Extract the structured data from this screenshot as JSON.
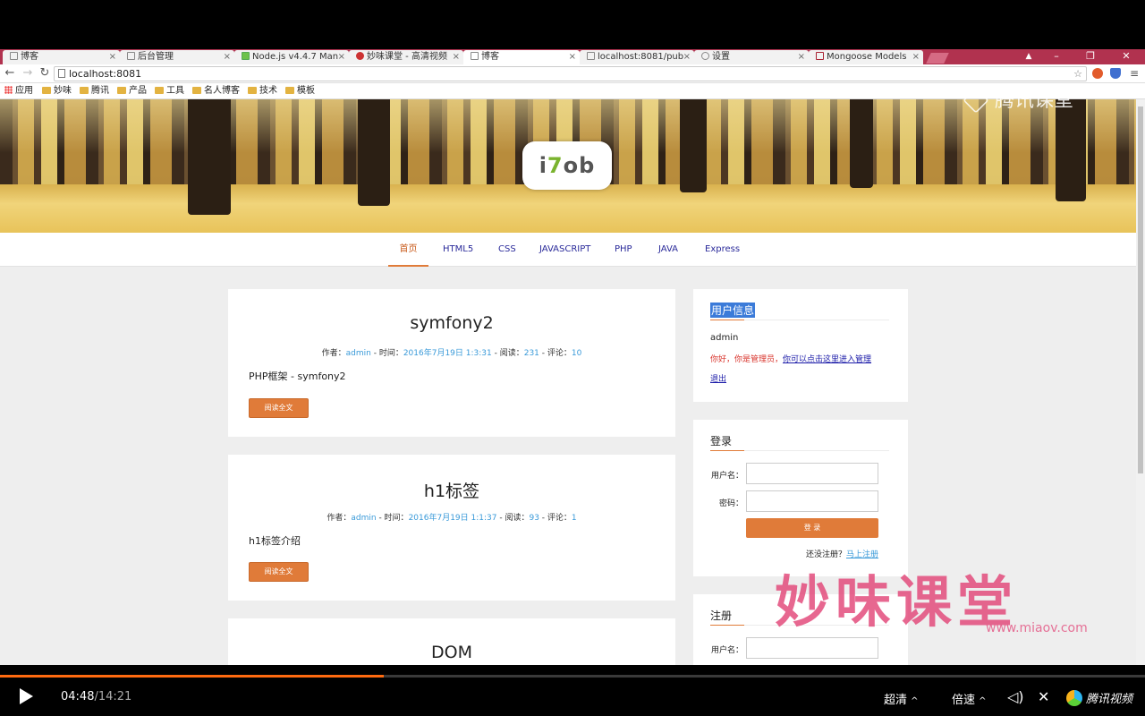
{
  "browser": {
    "tabs": [
      {
        "label": "博客",
        "active": false
      },
      {
        "label": "后台管理",
        "active": false
      },
      {
        "label": "Node.js v4.4.7 Man",
        "active": false
      },
      {
        "label": "妙味课堂 - 高清视频",
        "active": false
      },
      {
        "label": "博客",
        "active": true
      },
      {
        "label": "localhost:8081/pub",
        "active": false
      },
      {
        "label": "设置",
        "active": false
      },
      {
        "label": "Mongoose Models",
        "active": false
      }
    ],
    "url": "localhost:8081",
    "bookmarks": [
      "应用",
      "妙味",
      "腾讯",
      "产品",
      "工具",
      "名人博客",
      "技术",
      "模板"
    ],
    "window_controls": {
      "minimize": "–",
      "restore": "❐",
      "close": "✕"
    }
  },
  "site": {
    "logo": {
      "prefix": "i",
      "mid": "7",
      "suffix": "ob"
    },
    "nav": [
      "首页",
      "HTML5",
      "CSS",
      "JAVASCRIPT",
      "PHP",
      "JAVA",
      "Express"
    ],
    "nav_active": "首页",
    "posts": [
      {
        "title": "symfony2",
        "author_label": "作者：",
        "author": "admin",
        "time_label": " - 时间：",
        "time": "2016年7月19日 1:3:31",
        "views_label": " - 阅读：",
        "views": "231",
        "comments_label": " - 评论：",
        "comments": "10",
        "summary": "PHP框架 - symfony2",
        "read_more": "阅读全文"
      },
      {
        "title": "h1标签",
        "author_label": "作者：",
        "author": "admin",
        "time_label": " - 时间：",
        "time": "2016年7月19日 1:1:37",
        "views_label": " - 阅读：",
        "views": "93",
        "comments_label": " - 评论：",
        "comments": "1",
        "summary": "h1标签介绍",
        "read_more": "阅读全文"
      },
      {
        "title": "DOM"
      }
    ],
    "user_info": {
      "heading": "用户信息",
      "username": "admin",
      "admin_note": "你好，你是管理员，",
      "admin_link": "你可以点击这里进入管理",
      "logout": "退出"
    },
    "login": {
      "heading": "登录",
      "username_label": "用户名：",
      "password_label": "密码：",
      "submit": "登 录",
      "no_account": "还没注册？",
      "register_link": "马上注册"
    },
    "register": {
      "heading": "注册",
      "username_label": "用户名："
    }
  },
  "watermarks": {
    "top": "腾讯课堂",
    "main": "妙味课堂",
    "url": "www.miaov.com"
  },
  "player": {
    "current_time": "04:48",
    "duration": "/14:21",
    "progress_fraction": 0.335,
    "quality": "超清",
    "speed": "倍速",
    "brand": "腾讯视频"
  }
}
